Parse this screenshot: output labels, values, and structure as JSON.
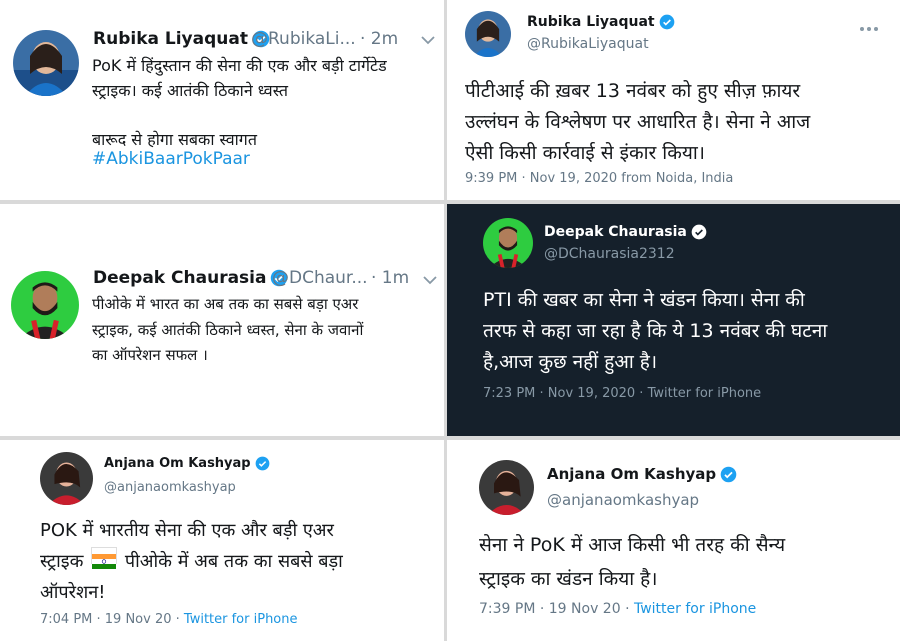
{
  "t1": {
    "name": "Rubika Liyaquat",
    "handle": "@RubikaLi...",
    "time": "· 2m",
    "body": "PoK में हिंदुस्तान की सेना की एक और बड़ी टार्गेटेड\nस्ट्राइक। कई आतंकी ठिकाने ध्वस्त\n\nबारूद से होगा सबका स्वागत",
    "hashtag": "#AbkiBaarPokPaar"
  },
  "t2": {
    "name": "Rubika Liyaquat",
    "handle": "@RubikaLiyaquat",
    "body": "पीटीआई की ख़बर 13 नवंबर को हुए सीज़ फ़ायर\nउल्लंघन के विश्लेषण पर आधारित है। सेना ने आज\nऐसी किसी कार्रवाई से इंकार किया।",
    "meta": "9:39 PM · Nov 19, 2020 from Noida, India"
  },
  "t3": {
    "name": "Deepak Chaurasia",
    "handle": "@DChaur...",
    "time": "· 1m",
    "body": "पीओके में भारत का अब तक का सबसे बड़ा एअर\nस्ट्राइक, कई आतंकी ठिकाने ध्वस्त,  सेना के जवानों\nका ऑपरेशन सफल ।"
  },
  "t4": {
    "name": "Deepak Chaurasia",
    "handle": "@DChaurasia2312",
    "body": "PTI की खबर का सेना ने खंडन किया। सेना की\nतरफ से कहा जा रहा है कि ये 13 नवंबर की घटना\nहै,आज कुछ नहीं हुआ है।",
    "meta_time": "7:23 PM · Nov 19, 2020 · ",
    "meta_src": "Twitter for iPhone"
  },
  "t5": {
    "name": "Anjana Om Kashyap",
    "handle": "@anjanaomkashyap",
    "body_1": "POK में भारतीय सेना की एक और बड़ी एअर",
    "body_2a": "स्ट्राइक ",
    "body_2b": " पीओके में अब तक का सबसे बड़ा",
    "body_3": "ऑपरेशन!",
    "meta_time": "7:04 PM · 19 Nov 20 · ",
    "meta_src": "Twitter for iPhone"
  },
  "t6": {
    "name": "Anjana Om Kashyap",
    "handle": "@anjanaomkashyap",
    "body": "सेना ने PoK में आज किसी भी तरह की सैन्य\nस्ट्राइक का खंडन किया है।",
    "meta_time": "7:39 PM · 19 Nov 20 · ",
    "meta_src": "Twitter for iPhone"
  },
  "colors": {
    "link": "#1b95e0",
    "dark_bg": "#15202b",
    "muted": "#657786"
  },
  "icons": [
    "verified-badge-icon",
    "more-options-icon",
    "chevron-down-icon",
    "india-flag-icon"
  ]
}
